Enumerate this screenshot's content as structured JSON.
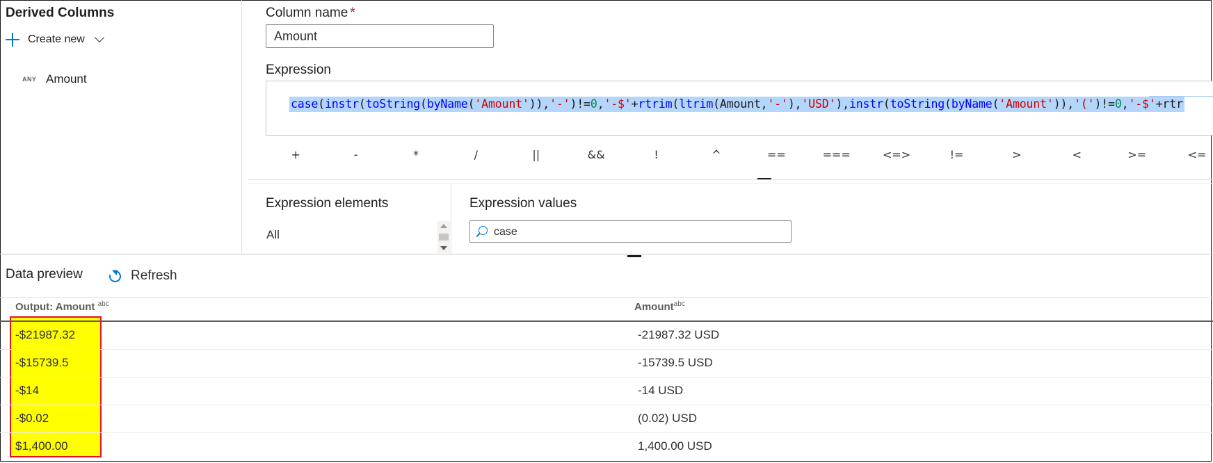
{
  "left_panel": {
    "title": "Derived Columns",
    "create_new_label": "Create new",
    "columns": [
      {
        "type_badge": "ANY",
        "name": "Amount"
      }
    ]
  },
  "column_name": {
    "label": "Column name",
    "required_mark": "*",
    "value": "Amount"
  },
  "expression": {
    "label": "Expression",
    "text": "case(instr(toString(byName('Amount')),'-')!=0,'-$'+rtrim(ltrim(Amount,'-'),'USD'),instr(toString(byName('Amount')),'(')!=0,'-$'+rtr"
  },
  "operators": [
    "+",
    "-",
    "*",
    "/",
    "||",
    "&&",
    "!",
    "^",
    "==",
    "===",
    "<=>",
    "!=",
    ">",
    "<",
    ">=",
    "<="
  ],
  "expression_elements": {
    "title": "Expression elements",
    "selected": "All"
  },
  "expression_values": {
    "title": "Expression values",
    "search_value": "case"
  },
  "data_preview": {
    "title": "Data preview",
    "refresh_label": "Refresh",
    "columns": [
      {
        "name": "Output: Amount ",
        "type": "abc"
      },
      {
        "name": "Amount",
        "type": "abc"
      }
    ],
    "rows": [
      [
        "-$21987.32",
        "-21987.32 USD"
      ],
      [
        "-$15739.5",
        "-15739.5 USD"
      ],
      [
        "-$14",
        "-14 USD"
      ],
      [
        "-$0.02",
        "(0.02) USD"
      ],
      [
        "$1,400.00",
        "1,400.00 USD"
      ]
    ]
  },
  "colors": {
    "accent": "#0078d4",
    "highlight_fill": "#ffff00",
    "highlight_border": "#e81123",
    "selection": "#b4d6fa"
  }
}
